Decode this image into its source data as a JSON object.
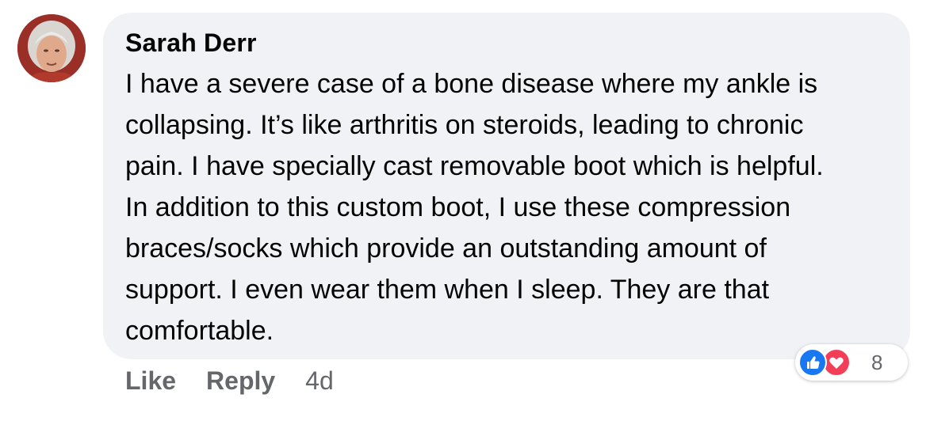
{
  "comment": {
    "author": "Sarah Derr",
    "text": "I have a severe case of a bone disease where my ankle is\ncollapsing. It’s like arthritis on steroids, leading to chronic\npain. I have specially cast removable boot which is helpful.\nIn addition to this custom boot, I use these compression\nbraces/socks which provide an outstanding amount of\nsupport. I even wear them when I sleep. They are that\ncomfortable.",
    "avatar_icon": "profile-photo"
  },
  "reactions": {
    "icons": [
      "like-icon",
      "love-icon"
    ],
    "count": "8",
    "like_color": "#1877f2",
    "love_color": "#f33e58"
  },
  "actions": {
    "like_label": "Like",
    "reply_label": "Reply",
    "timestamp": "4d"
  },
  "colors": {
    "bubble_background": "#f0f2f5",
    "secondary_text": "#65676b",
    "primary_text": "#050505"
  }
}
